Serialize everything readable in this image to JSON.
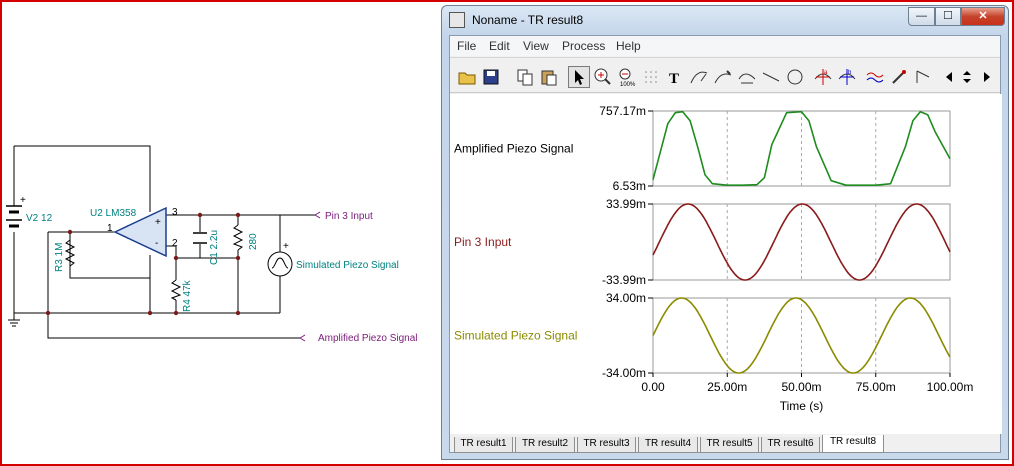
{
  "schematic": {
    "battery_label": "V2 12",
    "opamp_label": "U2 LM358",
    "r3_label": "R3 1M",
    "r4_label": "R4 47k",
    "c1_label": "C1 2.2u",
    "r280_label": "280",
    "pin_plus": "+",
    "pin_minus": "-",
    "pin_3": "3",
    "pin_1": "1",
    "pin_2": "2",
    "probe_pin3": "Pin 3 Input",
    "probe_amplified": "Amplified  Piezo Signal",
    "source_label": "Simulated Piezo Signal",
    "colors": {
      "wire": "#000000",
      "component": "#008080",
      "opamp": "#1a3f8f",
      "probe": "#7a1a7a"
    }
  },
  "window": {
    "title": "Noname - TR result8",
    "minimize": "—",
    "maximize": "☐",
    "close": "✕",
    "menu": [
      "File",
      "Edit",
      "View",
      "Process",
      "Help"
    ],
    "toolbar": [
      "open-icon",
      "save-icon",
      "copy-icon",
      "paste-icon",
      "pointer-icon",
      "zoom-in-icon",
      "zoom-100-icon",
      "grid-icon",
      "text-icon",
      "curve-tool-icon",
      "marker-icon",
      "tangent-icon",
      "line-icon",
      "circle-icon",
      "cursor-a-icon",
      "cursor-b-icon",
      "fft-icon",
      "probe-icon",
      "step-icon",
      "prev-icon",
      "updown-icon",
      "next-icon"
    ],
    "tabs": [
      "TR result1",
      "TR result2",
      "TR result3",
      "TR result4",
      "TR result5",
      "TR result6",
      "TR result8"
    ],
    "active_tab": "TR result8"
  },
  "chart_data": [
    {
      "type": "line",
      "series": [
        {
          "name": "Amplified  Piezo Signal",
          "color": "#1e8c1e"
        }
      ],
      "y_top_label": "757.17m",
      "y_bottom_label": "6.53m",
      "ylim": [
        0.00653,
        0.75717
      ],
      "x": [
        0,
        0.0025,
        0.005,
        0.0075,
        0.01,
        0.0125,
        0.015,
        0.0175,
        0.02,
        0.025,
        0.03,
        0.035,
        0.0375,
        0.04,
        0.045,
        0.05,
        0.0525,
        0.055,
        0.06,
        0.065,
        0.07,
        0.075,
        0.08,
        0.085,
        0.0875,
        0.09,
        0.0925,
        0.095,
        0.1
      ],
      "y": [
        0.07,
        0.35,
        0.63,
        0.74,
        0.75,
        0.66,
        0.4,
        0.12,
        0.03,
        0.015,
        0.015,
        0.02,
        0.09,
        0.42,
        0.74,
        0.75,
        0.66,
        0.4,
        0.06,
        0.015,
        0.015,
        0.015,
        0.03,
        0.4,
        0.66,
        0.75,
        0.72,
        0.55,
        0.28
      ]
    },
    {
      "type": "line",
      "series": [
        {
          "name": "Pin 3 Input",
          "color": "#8b1a1a"
        }
      ],
      "y_top_label": "33.99m",
      "y_bottom_label": "-33.99m",
      "ylim": [
        -0.03399,
        0.03399
      ],
      "waveform": "sine",
      "amplitude": 0.034,
      "period": 0.0385,
      "phase_deg": -20
    },
    {
      "type": "line",
      "series": [
        {
          "name": "Simulated Piezo Signal",
          "color": "#8b8b00"
        }
      ],
      "y_top_label": "34.00m",
      "y_bottom_label": "-34.00m",
      "ylim": [
        -0.034,
        0.034
      ],
      "waveform": "sine",
      "amplitude": 0.034,
      "period": 0.0385,
      "phase_deg": 0
    }
  ],
  "x_axis": {
    "tick_labels": [
      "0.00",
      "25.00m",
      "50.00m",
      "75.00m",
      "100.00m"
    ],
    "ticks": [
      0,
      0.025,
      0.05,
      0.075,
      0.1
    ],
    "xlabel": "Time (s)",
    "xlim": [
      0,
      0.1
    ]
  }
}
